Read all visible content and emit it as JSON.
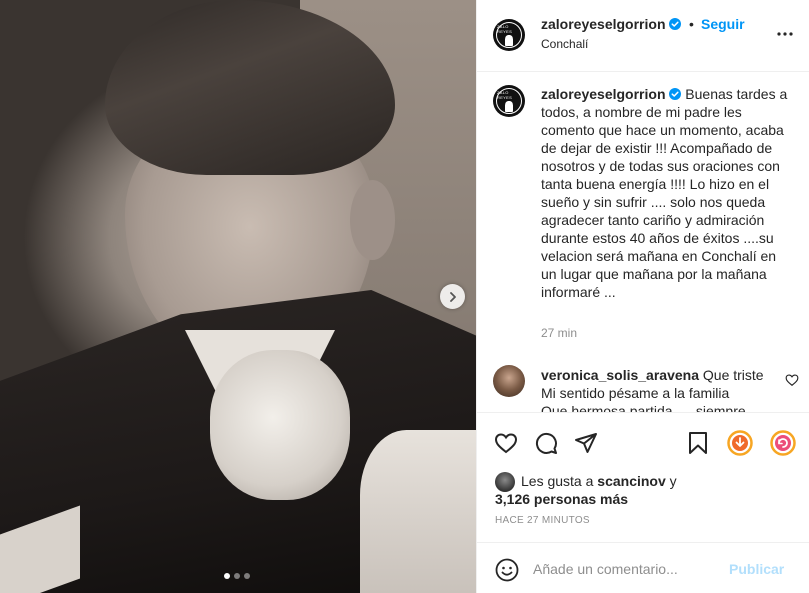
{
  "photo": {
    "carousel_dots": 3,
    "active_dot": 0
  },
  "header": {
    "username": "zaloreyeselgorrion",
    "separator": "•",
    "follow_label": "Seguir",
    "location": "Conchalí",
    "avatar_text": "ZALO REYES"
  },
  "caption": {
    "username": "zaloreyeselgorrion",
    "text": "Buenas tardes a todos, a nombre de mi padre les comento que hace un momento, acaba de dejar de existir !!! Acompañado de nosotros y de todas sus oraciones con tanta buena energía !!!! Lo hizo en el sueño y sin sufrir .... solo nos queda agradecer tanto cariño y admiración durante estos 40 años de éxitos ....su velacion será mañana en Conchalí en un lugar que mañana por la mañana informaré ...",
    "time_ago": "27 min"
  },
  "comment": {
    "username": "veronica_solis_aravena",
    "text_line1": "Que triste",
    "text_line2": "Mi sentido pésame a la familia",
    "text_line3": "Que hermosa partida .... siempre"
  },
  "likes": {
    "prefix": "Les gusta a",
    "user": "scancinov",
    "connector": "y",
    "count_text": "3,126 personas más"
  },
  "timestamp": "HACE 27 MINUTOS",
  "add_comment": {
    "placeholder": "Añade un comentario...",
    "publish_label": "Publicar"
  },
  "colors": {
    "accent": "#0095f6",
    "publish_disabled": "#b2dffc",
    "muted": "#8e8e8e",
    "text": "#262626"
  },
  "icons": [
    "chevron-right-icon",
    "more-icon",
    "verified-icon",
    "heart-icon",
    "comment-icon",
    "share-icon",
    "save-icon",
    "download-icon",
    "repost-icon",
    "emoji-icon"
  ]
}
